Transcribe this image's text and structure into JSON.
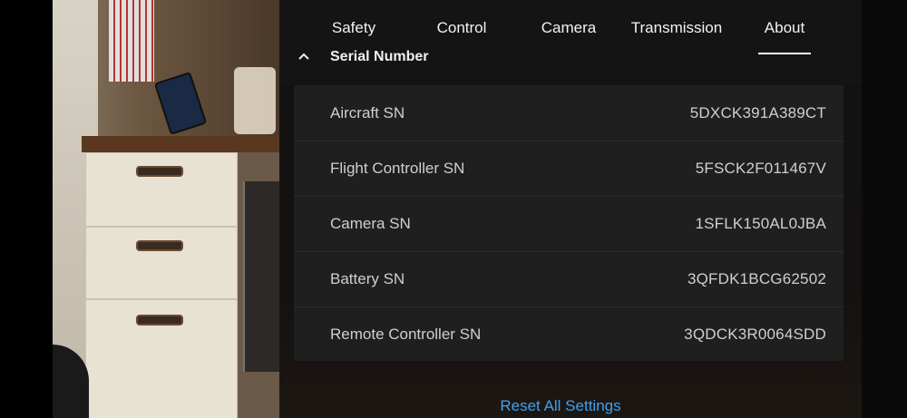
{
  "tabs": [
    {
      "label": "Safety"
    },
    {
      "label": "Control"
    },
    {
      "label": "Camera"
    },
    {
      "label": "Transmission"
    },
    {
      "label": "About"
    }
  ],
  "active_tab": "About",
  "section": {
    "title": "Serial Number"
  },
  "serials": [
    {
      "label": "Aircraft SN",
      "value": "5DXCK391A389CT"
    },
    {
      "label": "Flight Controller SN",
      "value": "5FSCK2F011467V"
    },
    {
      "label": "Camera SN",
      "value": "1SFLK150AL0JBA"
    },
    {
      "label": "Battery SN",
      "value": "3QFDK1BCG62502"
    },
    {
      "label": "Remote Controller SN",
      "value": "3QDCK3R0064SDD"
    }
  ],
  "reset_label": "Reset All Settings",
  "colors": {
    "accent": "#3da1f0",
    "panel_bg": "#1f1f1f"
  },
  "icons": {
    "collapse": "chevron-up-icon"
  }
}
